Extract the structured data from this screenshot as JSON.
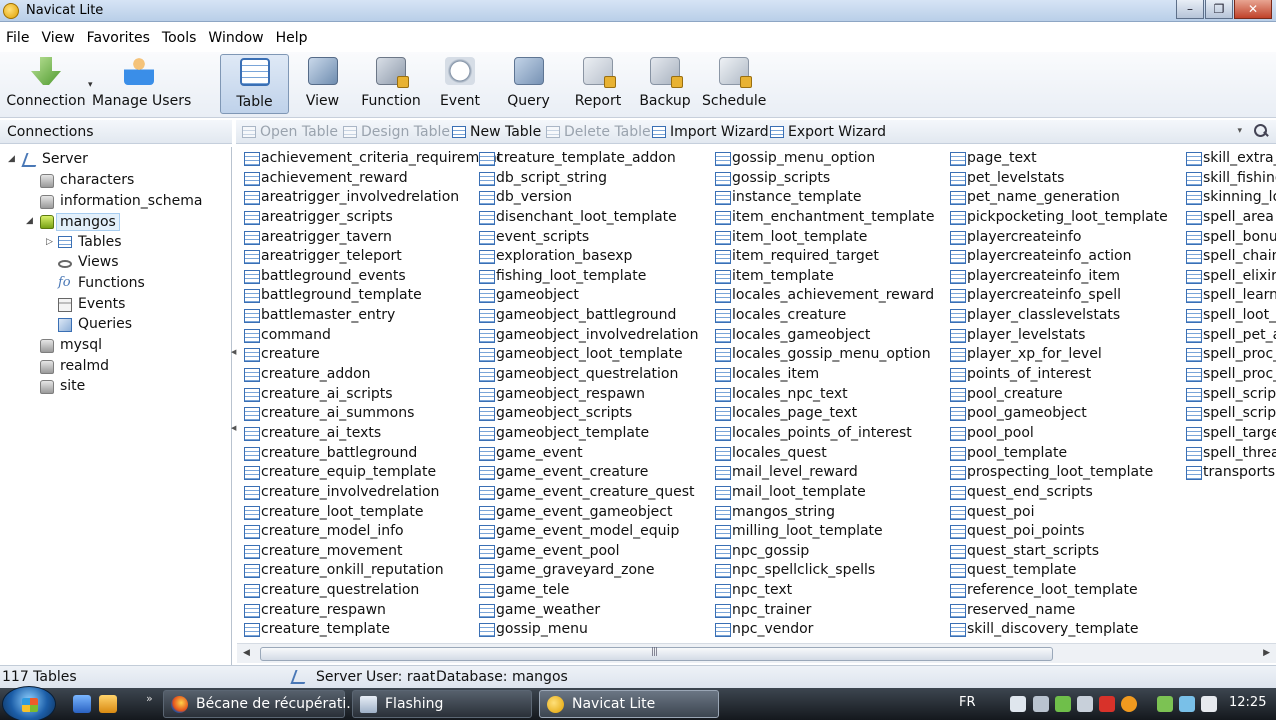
{
  "window": {
    "title": "Navicat Lite"
  },
  "menu": [
    "File",
    "View",
    "Favorites",
    "Tools",
    "Window",
    "Help"
  ],
  "toolbar": {
    "connection": "Connection",
    "manage_users": "Manage Users",
    "table": "Table",
    "view": "View",
    "function": "Function",
    "event": "Event",
    "query": "Query",
    "report": "Report",
    "backup": "Backup",
    "schedule": "Schedule"
  },
  "connections_header": "Connections",
  "object_toolbar": {
    "open_table": "Open Table",
    "design_table": "Design Table",
    "new_table": "New Table",
    "delete_table": "Delete Table",
    "import_wizard": "Import Wizard",
    "export_wizard": "Export Wizard"
  },
  "tree": {
    "server": "Server",
    "databases": [
      "characters",
      "information_schema",
      "mangos",
      "mysql",
      "realmd",
      "site"
    ],
    "mangos_children": [
      "Tables",
      "Views",
      "Functions",
      "Events",
      "Queries"
    ]
  },
  "tables": {
    "col1": [
      "achievement_criteria_requirement",
      "achievement_reward",
      "areatrigger_involvedrelation",
      "areatrigger_scripts",
      "areatrigger_tavern",
      "areatrigger_teleport",
      "battleground_events",
      "battleground_template",
      "battlemaster_entry",
      "command",
      "creature",
      "creature_addon",
      "creature_ai_scripts",
      "creature_ai_summons",
      "creature_ai_texts",
      "creature_battleground",
      "creature_equip_template",
      "creature_involvedrelation",
      "creature_loot_template",
      "creature_model_info",
      "creature_movement",
      "creature_onkill_reputation",
      "creature_questrelation",
      "creature_respawn",
      "creature_template"
    ],
    "col2": [
      "creature_template_addon",
      "db_script_string",
      "db_version",
      "disenchant_loot_template",
      "event_scripts",
      "exploration_basexp",
      "fishing_loot_template",
      "gameobject",
      "gameobject_battleground",
      "gameobject_involvedrelation",
      "gameobject_loot_template",
      "gameobject_questrelation",
      "gameobject_respawn",
      "gameobject_scripts",
      "gameobject_template",
      "game_event",
      "game_event_creature",
      "game_event_creature_quest",
      "game_event_gameobject",
      "game_event_model_equip",
      "game_event_pool",
      "game_graveyard_zone",
      "game_tele",
      "game_weather",
      "gossip_menu"
    ],
    "col3": [
      "gossip_menu_option",
      "gossip_scripts",
      "instance_template",
      "item_enchantment_template",
      "item_loot_template",
      "item_required_target",
      "item_template",
      "locales_achievement_reward",
      "locales_creature",
      "locales_gameobject",
      "locales_gossip_menu_option",
      "locales_item",
      "locales_npc_text",
      "locales_page_text",
      "locales_points_of_interest",
      "locales_quest",
      "mail_level_reward",
      "mail_loot_template",
      "mangos_string",
      "milling_loot_template",
      "npc_gossip",
      "npc_spellclick_spells",
      "npc_text",
      "npc_trainer",
      "npc_vendor"
    ],
    "col4": [
      "page_text",
      "pet_levelstats",
      "pet_name_generation",
      "pickpocketing_loot_template",
      "playercreateinfo",
      "playercreateinfo_action",
      "playercreateinfo_item",
      "playercreateinfo_spell",
      "player_classlevelstats",
      "player_levelstats",
      "player_xp_for_level",
      "points_of_interest",
      "pool_creature",
      "pool_gameobject",
      "pool_pool",
      "pool_template",
      "prospecting_loot_template",
      "quest_end_scripts",
      "quest_poi",
      "quest_poi_points",
      "quest_start_scripts",
      "quest_template",
      "reference_loot_template",
      "reserved_name",
      "skill_discovery_template"
    ],
    "col5": [
      "skill_extra_it",
      "skill_fishing_",
      "skinning_loo",
      "spell_area",
      "spell_bonus_",
      "spell_chain",
      "spell_elixir",
      "spell_learn_s",
      "spell_loot_te",
      "spell_pet_au",
      "spell_proc_e",
      "spell_proc_it",
      "spell_scripts",
      "spell_script_",
      "spell_target_",
      "spell_threat",
      "transports"
    ]
  },
  "status": {
    "count": "117 Tables",
    "server": "Server",
    "user": "User: raat",
    "database": "Database: mangos"
  },
  "taskbar": {
    "tasks": [
      "Bécane de récupérati...",
      "Flashing",
      "Navicat Lite"
    ],
    "language": "FR",
    "time": "12:25"
  }
}
